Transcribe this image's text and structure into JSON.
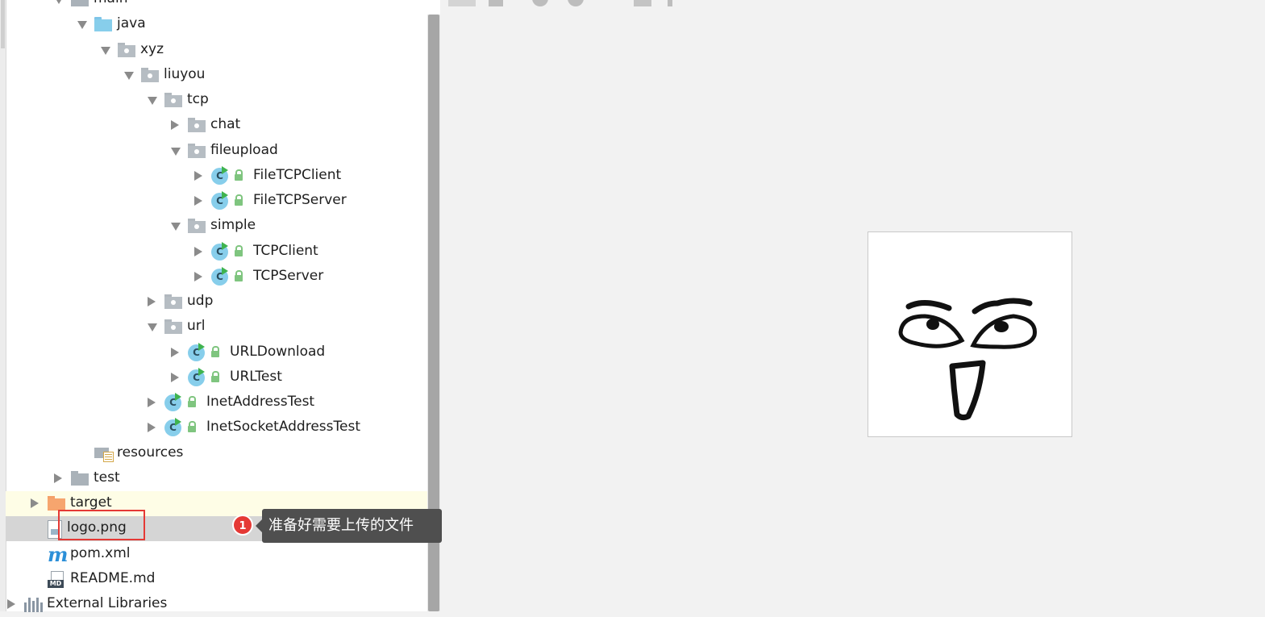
{
  "project_tree": {
    "items": [
      {
        "label": "main",
        "depth": 3,
        "expanded": true,
        "icon": "folder-icon"
      },
      {
        "label": "java",
        "depth": 4,
        "expanded": true,
        "icon": "source-folder-icon"
      },
      {
        "label": "xyz",
        "depth": 5,
        "expanded": true,
        "icon": "package-icon"
      },
      {
        "label": "liuyou",
        "depth": 6,
        "expanded": true,
        "icon": "package-icon"
      },
      {
        "label": "tcp",
        "depth": 7,
        "expanded": true,
        "icon": "package-icon"
      },
      {
        "label": "chat",
        "depth": 8,
        "expanded": false,
        "icon": "package-icon"
      },
      {
        "label": "fileupload",
        "depth": 8,
        "expanded": true,
        "icon": "package-icon"
      },
      {
        "label": "FileTCPClient",
        "depth": 9,
        "expanded": false,
        "icon": "java-class-icon"
      },
      {
        "label": "FileTCPServer",
        "depth": 9,
        "expanded": false,
        "icon": "java-class-icon"
      },
      {
        "label": "simple",
        "depth": 8,
        "expanded": true,
        "icon": "package-icon"
      },
      {
        "label": "TCPClient",
        "depth": 9,
        "expanded": false,
        "icon": "java-class-icon"
      },
      {
        "label": "TCPServer",
        "depth": 9,
        "expanded": false,
        "icon": "java-class-icon"
      },
      {
        "label": "udp",
        "depth": 7,
        "expanded": false,
        "icon": "package-icon"
      },
      {
        "label": "url",
        "depth": 7,
        "expanded": true,
        "icon": "package-icon"
      },
      {
        "label": "URLDownload",
        "depth": 8,
        "expanded": false,
        "icon": "java-class-icon"
      },
      {
        "label": "URLTest",
        "depth": 8,
        "expanded": false,
        "icon": "java-class-icon"
      },
      {
        "label": "InetAddressTest",
        "depth": 7,
        "expanded": false,
        "icon": "java-class-icon"
      },
      {
        "label": "InetSocketAddressTest",
        "depth": 7,
        "expanded": false,
        "icon": "java-class-icon"
      },
      {
        "label": "resources",
        "depth": 4,
        "expanded": null,
        "icon": "resources-folder-icon"
      },
      {
        "label": "test",
        "depth": 3,
        "expanded": false,
        "icon": "folder-icon"
      },
      {
        "label": "target",
        "depth": 2,
        "expanded": false,
        "icon": "excluded-folder-icon"
      },
      {
        "label": "logo.png",
        "depth": 2,
        "expanded": null,
        "icon": "image-file-icon"
      },
      {
        "label": "pom.xml",
        "depth": 2,
        "expanded": null,
        "icon": "maven-icon"
      },
      {
        "label": "README.md",
        "depth": 2,
        "expanded": null,
        "icon": "markdown-file-icon"
      },
      {
        "label": "External Libraries",
        "depth": 1,
        "expanded": false,
        "icon": "libraries-icon"
      }
    ],
    "highlighted_item": "target",
    "selected_item": "logo.png"
  },
  "annotation": {
    "badge_number": "1",
    "tooltip_text": "准备好需要上传的文件",
    "badge_color": "#e53935",
    "box_color": "#e53935"
  },
  "image_viewer": {
    "image_name": "face-drawing-icon"
  },
  "colors": {
    "source_folder": "#87ceeb",
    "package": "#b6bdc3",
    "excluded_folder": "#f6a56e",
    "row_highlight": "#fefde6",
    "row_selected": "#d5d5d5"
  }
}
